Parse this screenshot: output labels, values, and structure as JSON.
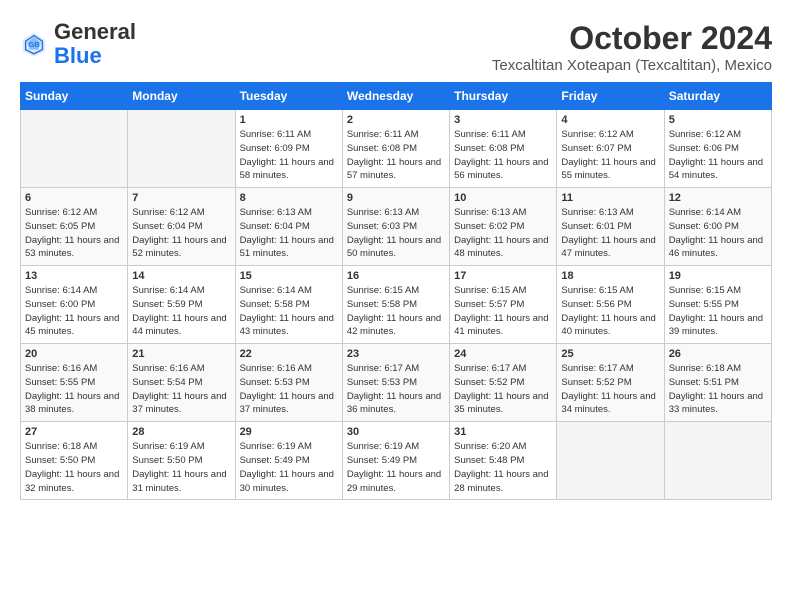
{
  "logo": {
    "general": "General",
    "blue": "Blue"
  },
  "header": {
    "month": "October 2024",
    "location": "Texcaltitan Xoteapan (Texcaltitan), Mexico"
  },
  "weekdays": [
    "Sunday",
    "Monday",
    "Tuesday",
    "Wednesday",
    "Thursday",
    "Friday",
    "Saturday"
  ],
  "weeks": [
    [
      {
        "day": "",
        "info": ""
      },
      {
        "day": "",
        "info": ""
      },
      {
        "day": "1",
        "info": "Sunrise: 6:11 AM\nSunset: 6:09 PM\nDaylight: 11 hours and 58 minutes."
      },
      {
        "day": "2",
        "info": "Sunrise: 6:11 AM\nSunset: 6:08 PM\nDaylight: 11 hours and 57 minutes."
      },
      {
        "day": "3",
        "info": "Sunrise: 6:11 AM\nSunset: 6:08 PM\nDaylight: 11 hours and 56 minutes."
      },
      {
        "day": "4",
        "info": "Sunrise: 6:12 AM\nSunset: 6:07 PM\nDaylight: 11 hours and 55 minutes."
      },
      {
        "day": "5",
        "info": "Sunrise: 6:12 AM\nSunset: 6:06 PM\nDaylight: 11 hours and 54 minutes."
      }
    ],
    [
      {
        "day": "6",
        "info": "Sunrise: 6:12 AM\nSunset: 6:05 PM\nDaylight: 11 hours and 53 minutes."
      },
      {
        "day": "7",
        "info": "Sunrise: 6:12 AM\nSunset: 6:04 PM\nDaylight: 11 hours and 52 minutes."
      },
      {
        "day": "8",
        "info": "Sunrise: 6:13 AM\nSunset: 6:04 PM\nDaylight: 11 hours and 51 minutes."
      },
      {
        "day": "9",
        "info": "Sunrise: 6:13 AM\nSunset: 6:03 PM\nDaylight: 11 hours and 50 minutes."
      },
      {
        "day": "10",
        "info": "Sunrise: 6:13 AM\nSunset: 6:02 PM\nDaylight: 11 hours and 48 minutes."
      },
      {
        "day": "11",
        "info": "Sunrise: 6:13 AM\nSunset: 6:01 PM\nDaylight: 11 hours and 47 minutes."
      },
      {
        "day": "12",
        "info": "Sunrise: 6:14 AM\nSunset: 6:00 PM\nDaylight: 11 hours and 46 minutes."
      }
    ],
    [
      {
        "day": "13",
        "info": "Sunrise: 6:14 AM\nSunset: 6:00 PM\nDaylight: 11 hours and 45 minutes."
      },
      {
        "day": "14",
        "info": "Sunrise: 6:14 AM\nSunset: 5:59 PM\nDaylight: 11 hours and 44 minutes."
      },
      {
        "day": "15",
        "info": "Sunrise: 6:14 AM\nSunset: 5:58 PM\nDaylight: 11 hours and 43 minutes."
      },
      {
        "day": "16",
        "info": "Sunrise: 6:15 AM\nSunset: 5:58 PM\nDaylight: 11 hours and 42 minutes."
      },
      {
        "day": "17",
        "info": "Sunrise: 6:15 AM\nSunset: 5:57 PM\nDaylight: 11 hours and 41 minutes."
      },
      {
        "day": "18",
        "info": "Sunrise: 6:15 AM\nSunset: 5:56 PM\nDaylight: 11 hours and 40 minutes."
      },
      {
        "day": "19",
        "info": "Sunrise: 6:15 AM\nSunset: 5:55 PM\nDaylight: 11 hours and 39 minutes."
      }
    ],
    [
      {
        "day": "20",
        "info": "Sunrise: 6:16 AM\nSunset: 5:55 PM\nDaylight: 11 hours and 38 minutes."
      },
      {
        "day": "21",
        "info": "Sunrise: 6:16 AM\nSunset: 5:54 PM\nDaylight: 11 hours and 37 minutes."
      },
      {
        "day": "22",
        "info": "Sunrise: 6:16 AM\nSunset: 5:53 PM\nDaylight: 11 hours and 37 minutes."
      },
      {
        "day": "23",
        "info": "Sunrise: 6:17 AM\nSunset: 5:53 PM\nDaylight: 11 hours and 36 minutes."
      },
      {
        "day": "24",
        "info": "Sunrise: 6:17 AM\nSunset: 5:52 PM\nDaylight: 11 hours and 35 minutes."
      },
      {
        "day": "25",
        "info": "Sunrise: 6:17 AM\nSunset: 5:52 PM\nDaylight: 11 hours and 34 minutes."
      },
      {
        "day": "26",
        "info": "Sunrise: 6:18 AM\nSunset: 5:51 PM\nDaylight: 11 hours and 33 minutes."
      }
    ],
    [
      {
        "day": "27",
        "info": "Sunrise: 6:18 AM\nSunset: 5:50 PM\nDaylight: 11 hours and 32 minutes."
      },
      {
        "day": "28",
        "info": "Sunrise: 6:19 AM\nSunset: 5:50 PM\nDaylight: 11 hours and 31 minutes."
      },
      {
        "day": "29",
        "info": "Sunrise: 6:19 AM\nSunset: 5:49 PM\nDaylight: 11 hours and 30 minutes."
      },
      {
        "day": "30",
        "info": "Sunrise: 6:19 AM\nSunset: 5:49 PM\nDaylight: 11 hours and 29 minutes."
      },
      {
        "day": "31",
        "info": "Sunrise: 6:20 AM\nSunset: 5:48 PM\nDaylight: 11 hours and 28 minutes."
      },
      {
        "day": "",
        "info": ""
      },
      {
        "day": "",
        "info": ""
      }
    ]
  ]
}
